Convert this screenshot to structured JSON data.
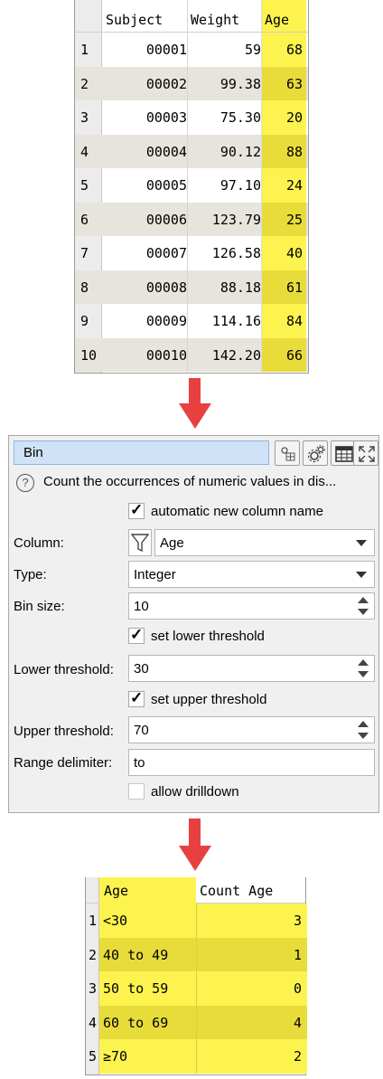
{
  "input_table": {
    "columns": [
      "Subject",
      "Weight",
      "Age"
    ],
    "rows": [
      {
        "n": "1",
        "subject": "00001",
        "weight": "59",
        "age": "68"
      },
      {
        "n": "2",
        "subject": "00002",
        "weight": "99.38",
        "age": "63"
      },
      {
        "n": "3",
        "subject": "00003",
        "weight": "75.30",
        "age": "20"
      },
      {
        "n": "4",
        "subject": "00004",
        "weight": "90.12",
        "age": "88"
      },
      {
        "n": "5",
        "subject": "00005",
        "weight": "97.10",
        "age": "24"
      },
      {
        "n": "6",
        "subject": "00006",
        "weight": "123.79",
        "age": "25"
      },
      {
        "n": "7",
        "subject": "00007",
        "weight": "126.58",
        "age": "40"
      },
      {
        "n": "8",
        "subject": "00008",
        "weight": "88.18",
        "age": "61"
      },
      {
        "n": "9",
        "subject": "00009",
        "weight": "114.16",
        "age": "84"
      },
      {
        "n": "10",
        "subject": "00010",
        "weight": "142.20",
        "age": "66"
      }
    ]
  },
  "dialog": {
    "title": "Bin",
    "help_text": "Count the occurrences of numeric values in dis...",
    "auto_name_label": "automatic new column name",
    "auto_name_checked": true,
    "column_label": "Column:",
    "column_value": "Age",
    "type_label": "Type:",
    "type_value": "Integer",
    "bin_size_label": "Bin size:",
    "bin_size_value": "10",
    "set_lower_label": "set lower threshold",
    "set_lower_checked": true,
    "lower_label": "Lower threshold:",
    "lower_value": "30",
    "set_upper_label": "set upper threshold",
    "set_upper_checked": true,
    "upper_label": "Upper threshold:",
    "upper_value": "70",
    "range_delim_label": "Range delimiter:",
    "range_delim_value": "to",
    "drilldown_label": "allow drilldown",
    "drilldown_checked": false
  },
  "output_table": {
    "columns": [
      "Age",
      "Count Age"
    ],
    "rows": [
      {
        "n": "1",
        "age": "<30",
        "count": "3"
      },
      {
        "n": "2",
        "age": "40 to 49",
        "count": "1"
      },
      {
        "n": "3",
        "age": "50 to 59",
        "count": "0"
      },
      {
        "n": "4",
        "age": "60 to 69",
        "count": "4"
      },
      {
        "n": "5",
        "age": "≥70",
        "count": "2"
      }
    ]
  },
  "colors": {
    "highlight": "#fdf34e",
    "highlight_alt": "#e8dc3a",
    "arrow": "#e84040",
    "title_bar": "#cfe2f7"
  },
  "icons": [
    "filter-icon",
    "gear-icon",
    "table-icon",
    "expand-icon",
    "help-icon"
  ]
}
